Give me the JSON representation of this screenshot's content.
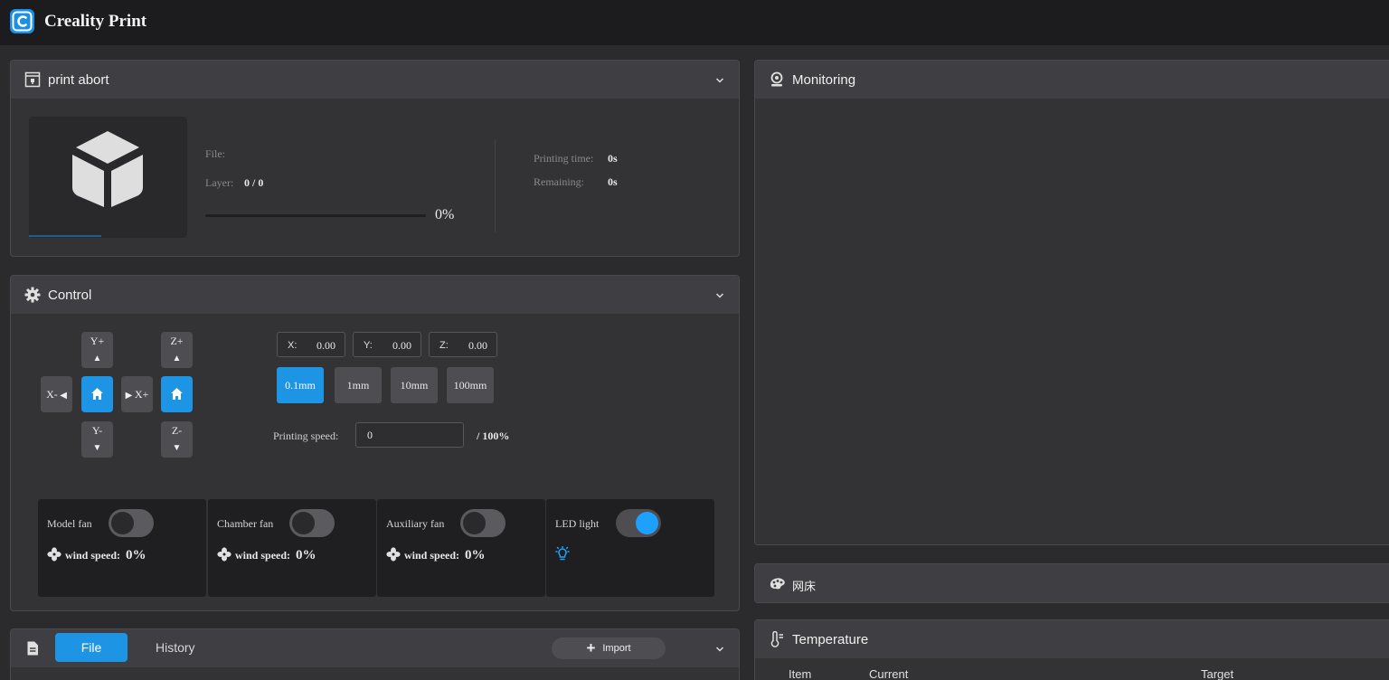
{
  "app": {
    "title": "Creality Print",
    "accent": "#1e94e4"
  },
  "print": {
    "title": "print abort",
    "file_label": "File:",
    "file_value": "",
    "layer_label": "Layer:",
    "layer_value": "0 / 0",
    "progress_percent": "0%",
    "progress_fraction": 0,
    "printing_time_label": "Printing time:",
    "printing_time_value": "0s",
    "remaining_label": "Remaining:",
    "remaining_value": "0s"
  },
  "control": {
    "title": "Control",
    "jog": {
      "y_plus": "Y+",
      "y_minus": "Y-",
      "x_minus": "X-",
      "x_plus": "X+",
      "z_plus": "Z+",
      "z_minus": "Z-"
    },
    "coords": [
      {
        "axis": "X:",
        "value": "0.00"
      },
      {
        "axis": "Y:",
        "value": "0.00"
      },
      {
        "axis": "Z:",
        "value": "0.00"
      }
    ],
    "steps": [
      "0.1mm",
      "1mm",
      "10mm",
      "100mm"
    ],
    "active_step": "0.1mm",
    "speed_label": "Printing speed:",
    "speed_value": "0",
    "speed_max": "/ 100%",
    "fans": [
      {
        "name": "Model fan",
        "on": false,
        "ws_label": "wind speed:",
        "ws_value": "0%"
      },
      {
        "name": "Chamber fan",
        "on": false,
        "ws_label": "wind speed:",
        "ws_value": "0%"
      },
      {
        "name": "Auxiliary fan",
        "on": false,
        "ws_label": "wind speed:",
        "ws_value": "0%"
      }
    ],
    "led": {
      "name": "LED light",
      "on": true
    }
  },
  "files": {
    "tab_file": "File",
    "tab_history": "History",
    "import_label": "Import"
  },
  "monitoring": {
    "title": "Monitoring"
  },
  "mesh": {
    "title": "网床"
  },
  "temperature": {
    "title": "Temperature",
    "columns": [
      "Item",
      "Current",
      "Target"
    ]
  }
}
